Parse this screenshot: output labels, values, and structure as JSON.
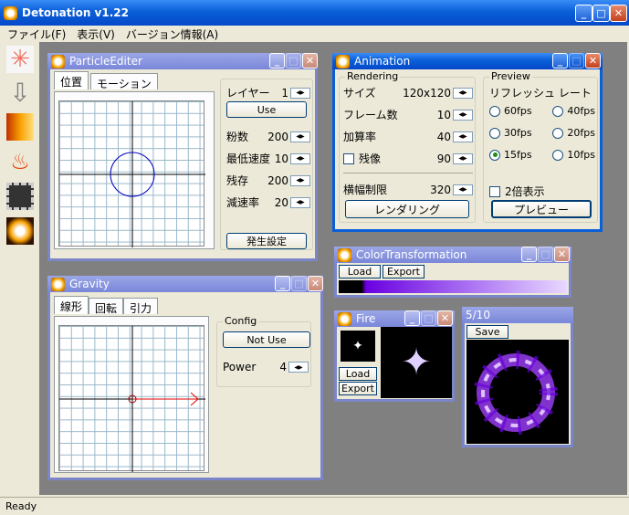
{
  "app": {
    "title": "Detonation v1.22"
  },
  "menu": [
    {
      "label": "ファイル(F)"
    },
    {
      "label": "表示(V)"
    },
    {
      "label": "バージョン情報(A)"
    }
  ],
  "status": "Ready",
  "toolbar_icons": [
    "burst-icon",
    "arrow-down-icon",
    "gradient-icon",
    "fire-icon",
    "film-icon",
    "explosion-icon"
  ],
  "particle_editor": {
    "title": "ParticleEditer",
    "tabs": [
      "位置",
      "モーション"
    ],
    "layer_label": "レイヤー",
    "layer_value": "1",
    "use_button": "Use",
    "fields": [
      {
        "label": "粉数",
        "value": "200"
      },
      {
        "label": "最低速度",
        "value": "10"
      },
      {
        "label": "残存",
        "value": "200"
      },
      {
        "label": "減速率",
        "value": "20"
      }
    ],
    "generate_button": "発生設定"
  },
  "gravity": {
    "title": "Gravity",
    "tabs": [
      "線形",
      "回転",
      "引力"
    ],
    "config_label": "Config",
    "not_use_button": "Not Use",
    "power_label": "Power",
    "power_value": "4"
  },
  "animation": {
    "title": "Animation",
    "rendering_label": "Rendering",
    "size_label": "サイズ",
    "size_value": "120x120",
    "frames_label": "フレーム数",
    "frames_value": "10",
    "accel_label": "加算率",
    "accel_value": "40",
    "afterimage_label": "残像",
    "afterimage_value": "90",
    "width_limit_label": "横幅制限",
    "width_limit_value": "320",
    "render_button": "レンダリング",
    "preview_label": "Preview",
    "refresh_label": "リフレッシュ レート",
    "fps": [
      "60fps",
      "40fps",
      "30fps",
      "20fps",
      "15fps",
      "10fps"
    ],
    "fps_selected": "15fps",
    "double_label": "2倍表示",
    "preview_button": "プレビュー"
  },
  "color_transformation": {
    "title": "ColorTransformation",
    "load": "Load",
    "export": "Export",
    "gradient": [
      "#000000",
      "#6a00e0",
      "#a060f0",
      "#e8d8ff"
    ]
  },
  "fire": {
    "title": "Fire",
    "load": "Load",
    "export": "Export"
  },
  "preview_window": {
    "title": "5/10",
    "save": "Save"
  }
}
